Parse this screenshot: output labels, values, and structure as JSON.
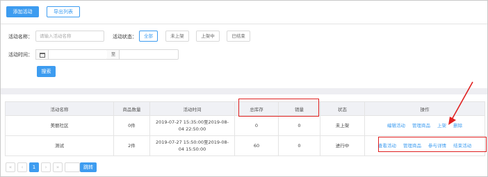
{
  "toolbar": {
    "add_label": "添加活动",
    "export_label": "导出列表"
  },
  "filters": {
    "name_label": "活动名称：",
    "name_placeholder": "请输入活动名称",
    "status_label": "活动状态：",
    "statuses": [
      "全部",
      "未上架",
      "上架中",
      "已结束"
    ],
    "active_status": "全部",
    "time_label": "活动时间：",
    "time_separator": "至",
    "search_label": "搜索"
  },
  "table": {
    "headers": [
      "活动名称",
      "商品数量",
      "活动时间",
      "总库存",
      "销量",
      "状态",
      "操作"
    ],
    "rows": [
      {
        "name": "美丽社区",
        "count": "0件",
        "time": "2019-07-27 15:35:00至2019-08-04 22:50:00",
        "stock": "0",
        "sales": "0",
        "status": "未上架",
        "actions": [
          "编辑活动",
          "管理商品",
          "上架",
          "删除"
        ]
      },
      {
        "name": "测试",
        "count": "2件",
        "time": "2019-07-27 15:50:00至2019-08-04 15:50:00",
        "stock": "60",
        "sales": "0",
        "status": "进行中",
        "actions": [
          "查看活动",
          "管理商品",
          "参与详情",
          "结束活动"
        ]
      }
    ]
  },
  "pagination": {
    "first": "«",
    "prev": "‹",
    "current": "1",
    "next": "›",
    "last": "»",
    "goto_label": "跳转"
  },
  "colors": {
    "accent": "#3d9cf0",
    "highlight": "#e02020"
  }
}
